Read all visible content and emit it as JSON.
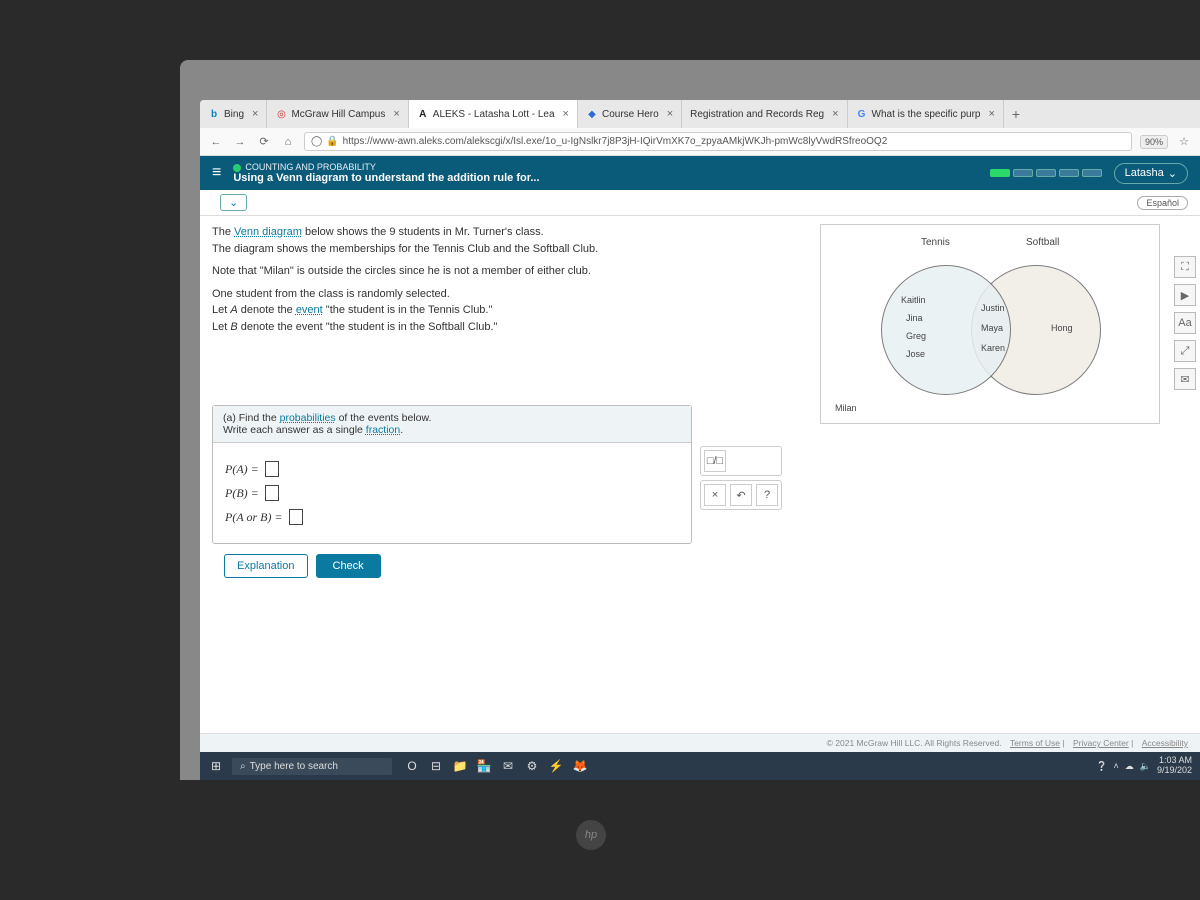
{
  "browser_tabs": [
    {
      "icon": "b",
      "icon_color": "#0a84c1",
      "label": "Bing"
    },
    {
      "icon": "◎",
      "icon_color": "#c33",
      "label": "McGraw Hill Campus"
    },
    {
      "icon": "A",
      "icon_color": "#222",
      "label": "ALEKS - Latasha Lott - Lea",
      "active": true
    },
    {
      "icon": "◆",
      "icon_color": "#2a6bd4",
      "label": "Course Hero"
    },
    {
      "icon": "",
      "icon_color": "",
      "label": "Registration and Records Reg"
    },
    {
      "icon": "G",
      "icon_color": "#4285f4",
      "label": "What is the specific purp"
    }
  ],
  "url_bar": {
    "url": "https://www-awn.aleks.com/alekscgi/x/Isl.exe/1o_u-IgNslkr7j8P3jH-IQirVmXK7o_zpyaAMkjWKJh-pmWc8lyVwdRSfreoOQ2",
    "zoom": "90%"
  },
  "aleks": {
    "section_label": "COUNTING AND PROBABILITY",
    "topic_title": "Using a Venn diagram to understand the addition rule for...",
    "user_name": "Latasha",
    "lang_btn": "Español"
  },
  "problem": {
    "p1a": "The ",
    "p1link": "Venn diagram",
    "p1b": " below shows the 9 students in Mr. Turner's class.",
    "p2": "The diagram shows the memberships for the Tennis Club and the Softball Club.",
    "p3": "Note that \"Milan\" is outside the circles since he is not a member of either club.",
    "p4": "One student from the class is randomly selected.",
    "p5a": "Let ",
    "p5var": "A",
    "p5b": " denote the ",
    "p5link": "event",
    "p5c": " \"the student is in the Tennis Club.\"",
    "p6a": "Let ",
    "p6var": "B",
    "p6b": " denote the event \"the student is in the Softball Club.\""
  },
  "venn": {
    "left_label": "Tennis",
    "right_label": "Softball",
    "tennis_only": [
      "Kaitlin",
      "Jina",
      "Greg",
      "Jose"
    ],
    "both": [
      "Justin",
      "Maya",
      "Karen"
    ],
    "softball_only": [
      "Hong"
    ],
    "outside": "Milan"
  },
  "answer_card": {
    "head_a": "(a) Find the ",
    "head_link1": "probabilities",
    "head_b": " of the events below.",
    "head_c": "Write each answer as a single ",
    "head_link2": "fraction",
    "head_d": ".",
    "eq1": "P(A) =",
    "eq2": "P(B) =",
    "eq3": "P(A or B) ="
  },
  "mini_toolbar": {
    "r1": [
      "□/□"
    ],
    "r2": [
      "×",
      "↶",
      "?"
    ]
  },
  "side_tools": [
    "⛶",
    "▶",
    "Aa",
    "⤢",
    "✉"
  ],
  "actions": {
    "explanation": "Explanation",
    "check": "Check"
  },
  "copyright": {
    "main": "© 2021 McGraw Hill LLC. All Rights Reserved.",
    "links": [
      "Terms of Use",
      "Privacy Center",
      "Accessibility"
    ]
  },
  "taskbar": {
    "search_placeholder": "Type here to search",
    "icons": [
      "O",
      "⊟",
      "📁",
      "🏪",
      "✉",
      "⚙",
      "⚡",
      "🦊"
    ],
    "tray_icons": [
      "❔",
      "˄",
      "☁",
      "🔈"
    ],
    "time": "1:03 AM",
    "date": "9/19/202"
  }
}
